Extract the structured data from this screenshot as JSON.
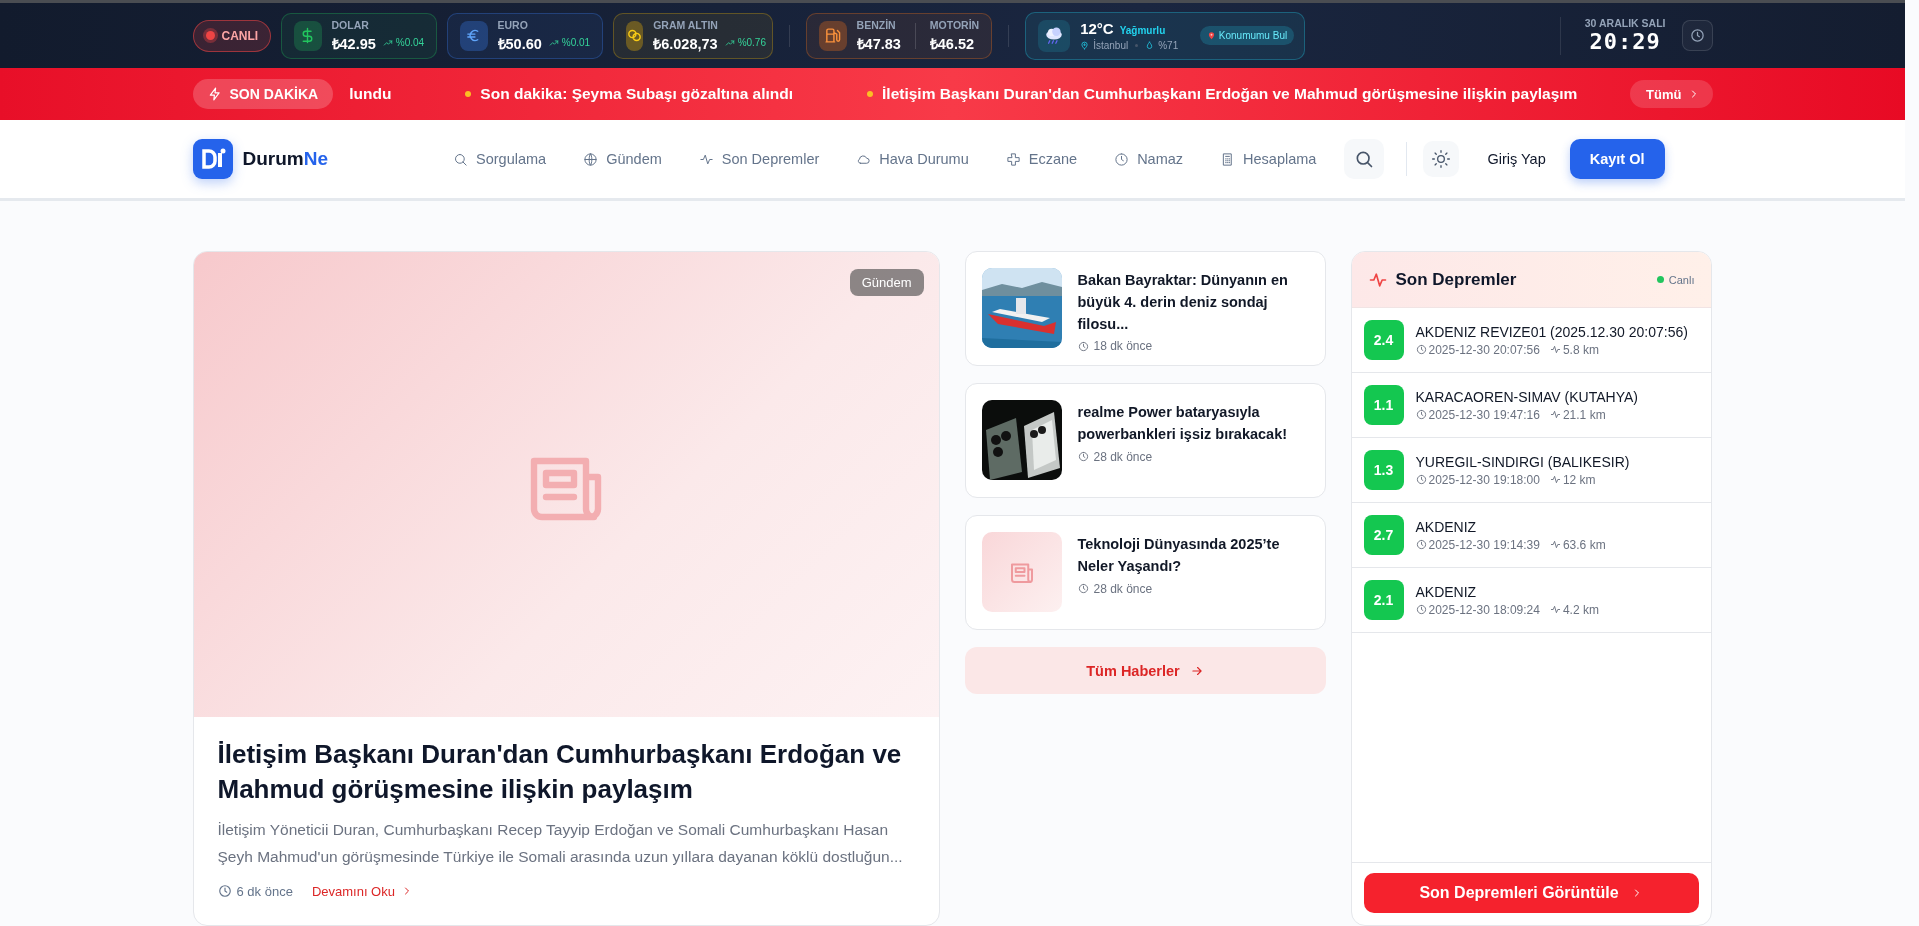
{
  "top_bar": {
    "live_label": "CANLI",
    "rates": [
      {
        "kind": "dollar",
        "label": "DOLAR",
        "value": "₺42.95",
        "change": "%0.04"
      },
      {
        "kind": "euro",
        "label": "EURO",
        "value": "₺50.60",
        "change": "%0.01"
      },
      {
        "kind": "gold",
        "label": "GRAM ALTIN",
        "value": "₺6.028,73",
        "change": "%0.76"
      }
    ],
    "fuel": [
      {
        "label": "BENZİN",
        "value": "₺47.83"
      },
      {
        "label": "MOTORİN",
        "value": "₺46.52"
      }
    ],
    "weather": {
      "temperature": "12°C",
      "condition": "Yağmurlu",
      "city": "İstanbul",
      "humidity": "%71",
      "button": "Konumumu Bul"
    },
    "date": "30 ARALIK SALI",
    "time": "20:29"
  },
  "ticker": {
    "label": "SON DAKİKA",
    "items": [
      {
        "text": "lundu",
        "bullet": false
      },
      {
        "text": "Son dakika: Şeyma Subaşı gözaltına alındı",
        "bullet": true
      },
      {
        "text": "İletişim Başkanı Duran'dan Cumhurbaşkanı Erdoğan ve Mahmud görüşmesine ilişkin paylaşım",
        "bullet": true
      }
    ],
    "button": "Tümü"
  },
  "nav": {
    "logo": {
      "first": "Durum",
      "second": "Ne"
    },
    "items": [
      "Sorgulama",
      "Gündem",
      "Son Depremler",
      "Hava Durumu",
      "Eczane",
      "Namaz",
      "Hesaplama"
    ],
    "login": "Giriş Yap",
    "register": "Kayıt Ol"
  },
  "featured": {
    "badge": "Gündem",
    "title": "İletişim Başkanı Duran'dan Cumhurbaşkanı Erdoğan ve Mahmud görüşmesine ilişkin paylaşım",
    "summary": "İletişim Yöneticii Duran, Cumhurbaşkanı Recep Tayyip Erdoğan ve Somali Cumhurbaşkanı Hasan Şeyh Mahmud'un görüşmesinde Türkiye ile Somali arasında uzun yıllara dayanan köklü dostluğun...",
    "time": "6 dk önce",
    "read_more": "Devamını Oku"
  },
  "news": [
    {
      "title": "Bakan Bayraktar: Dünyanın en büyük 4. derin deniz sondaj filosu...",
      "time": "18 dk önce"
    },
    {
      "title": "realme Power bataryasıyla powerbankleri işsiz bırakacak!",
      "time": "28 dk önce"
    },
    {
      "kind": "placeholder",
      "title": "Teknoloji Dünyasında 2025’te Neler Yaşandı?",
      "time": "28 dk önce"
    }
  ],
  "all_news_button": "Tüm Haberler",
  "earthquakes": {
    "title": "Son Depremler",
    "live": "Canlı",
    "items": [
      {
        "magnitude": "2.4",
        "place": "AKDENIZ REVIZE01 (2025.12.30 20:07:56)",
        "time": "2025-12-30 20:07:56",
        "depth": "5.8 km"
      },
      {
        "magnitude": "1.1",
        "place": "KARACAOREN-SIMAV (KUTAHYA)",
        "time": "2025-12-30 19:47:16",
        "depth": "21.1 km"
      },
      {
        "magnitude": "1.3",
        "place": "YUREGIL-SINDIRGI (BALIKESIR)",
        "time": "2025-12-30 19:18:00",
        "depth": "12 km"
      },
      {
        "magnitude": "2.7",
        "place": "AKDENIZ",
        "time": "2025-12-30 19:14:39",
        "depth": "63.6 km"
      },
      {
        "magnitude": "2.1",
        "place": "AKDENIZ",
        "time": "2025-12-30 18:09:24",
        "depth": "4.2 km"
      }
    ],
    "button": "Son Depremleri Görüntüle"
  }
}
